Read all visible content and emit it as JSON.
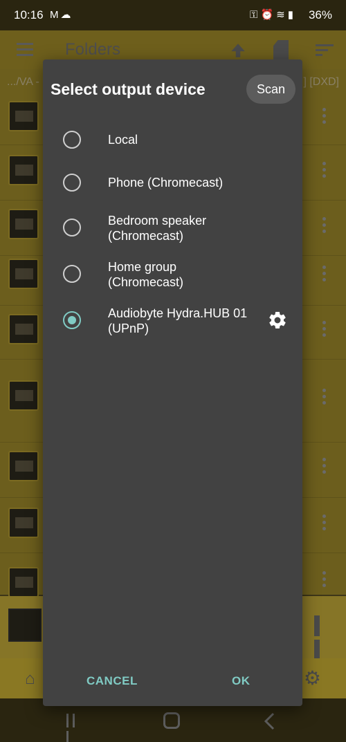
{
  "status_bar": {
    "time": "10:16",
    "left_icons": [
      "gmail-icon",
      "cloud-icon"
    ],
    "right_icons": [
      "key-icon",
      "alarm-icon",
      "wifi-icon",
      "signal-icon"
    ],
    "battery": "36%"
  },
  "app": {
    "toolbar_title": "Folders",
    "path": ".../VA -",
    "path_suffix": "] [DXD]"
  },
  "dialog": {
    "title": "Select output device",
    "scan_label": "Scan",
    "devices": [
      {
        "line1": "Local",
        "line2": "",
        "selected": false
      },
      {
        "line1": "Phone (Chromecast)",
        "line2": "",
        "selected": false
      },
      {
        "line1": "Bedroom speaker",
        "line2": "(Chromecast)",
        "selected": false
      },
      {
        "line1": "Home group",
        "line2": "(Chromecast)",
        "selected": false
      },
      {
        "line1": "Audiobyte Hydra.HUB 01",
        "line2": "(UPnP)",
        "selected": true,
        "has_settings": true
      }
    ],
    "cancel_label": "CANCEL",
    "ok_label": "OK"
  },
  "colors": {
    "accent": "#80cbc4",
    "dialog_bg": "#424242",
    "scrim_bg": "#6c5e1d"
  }
}
